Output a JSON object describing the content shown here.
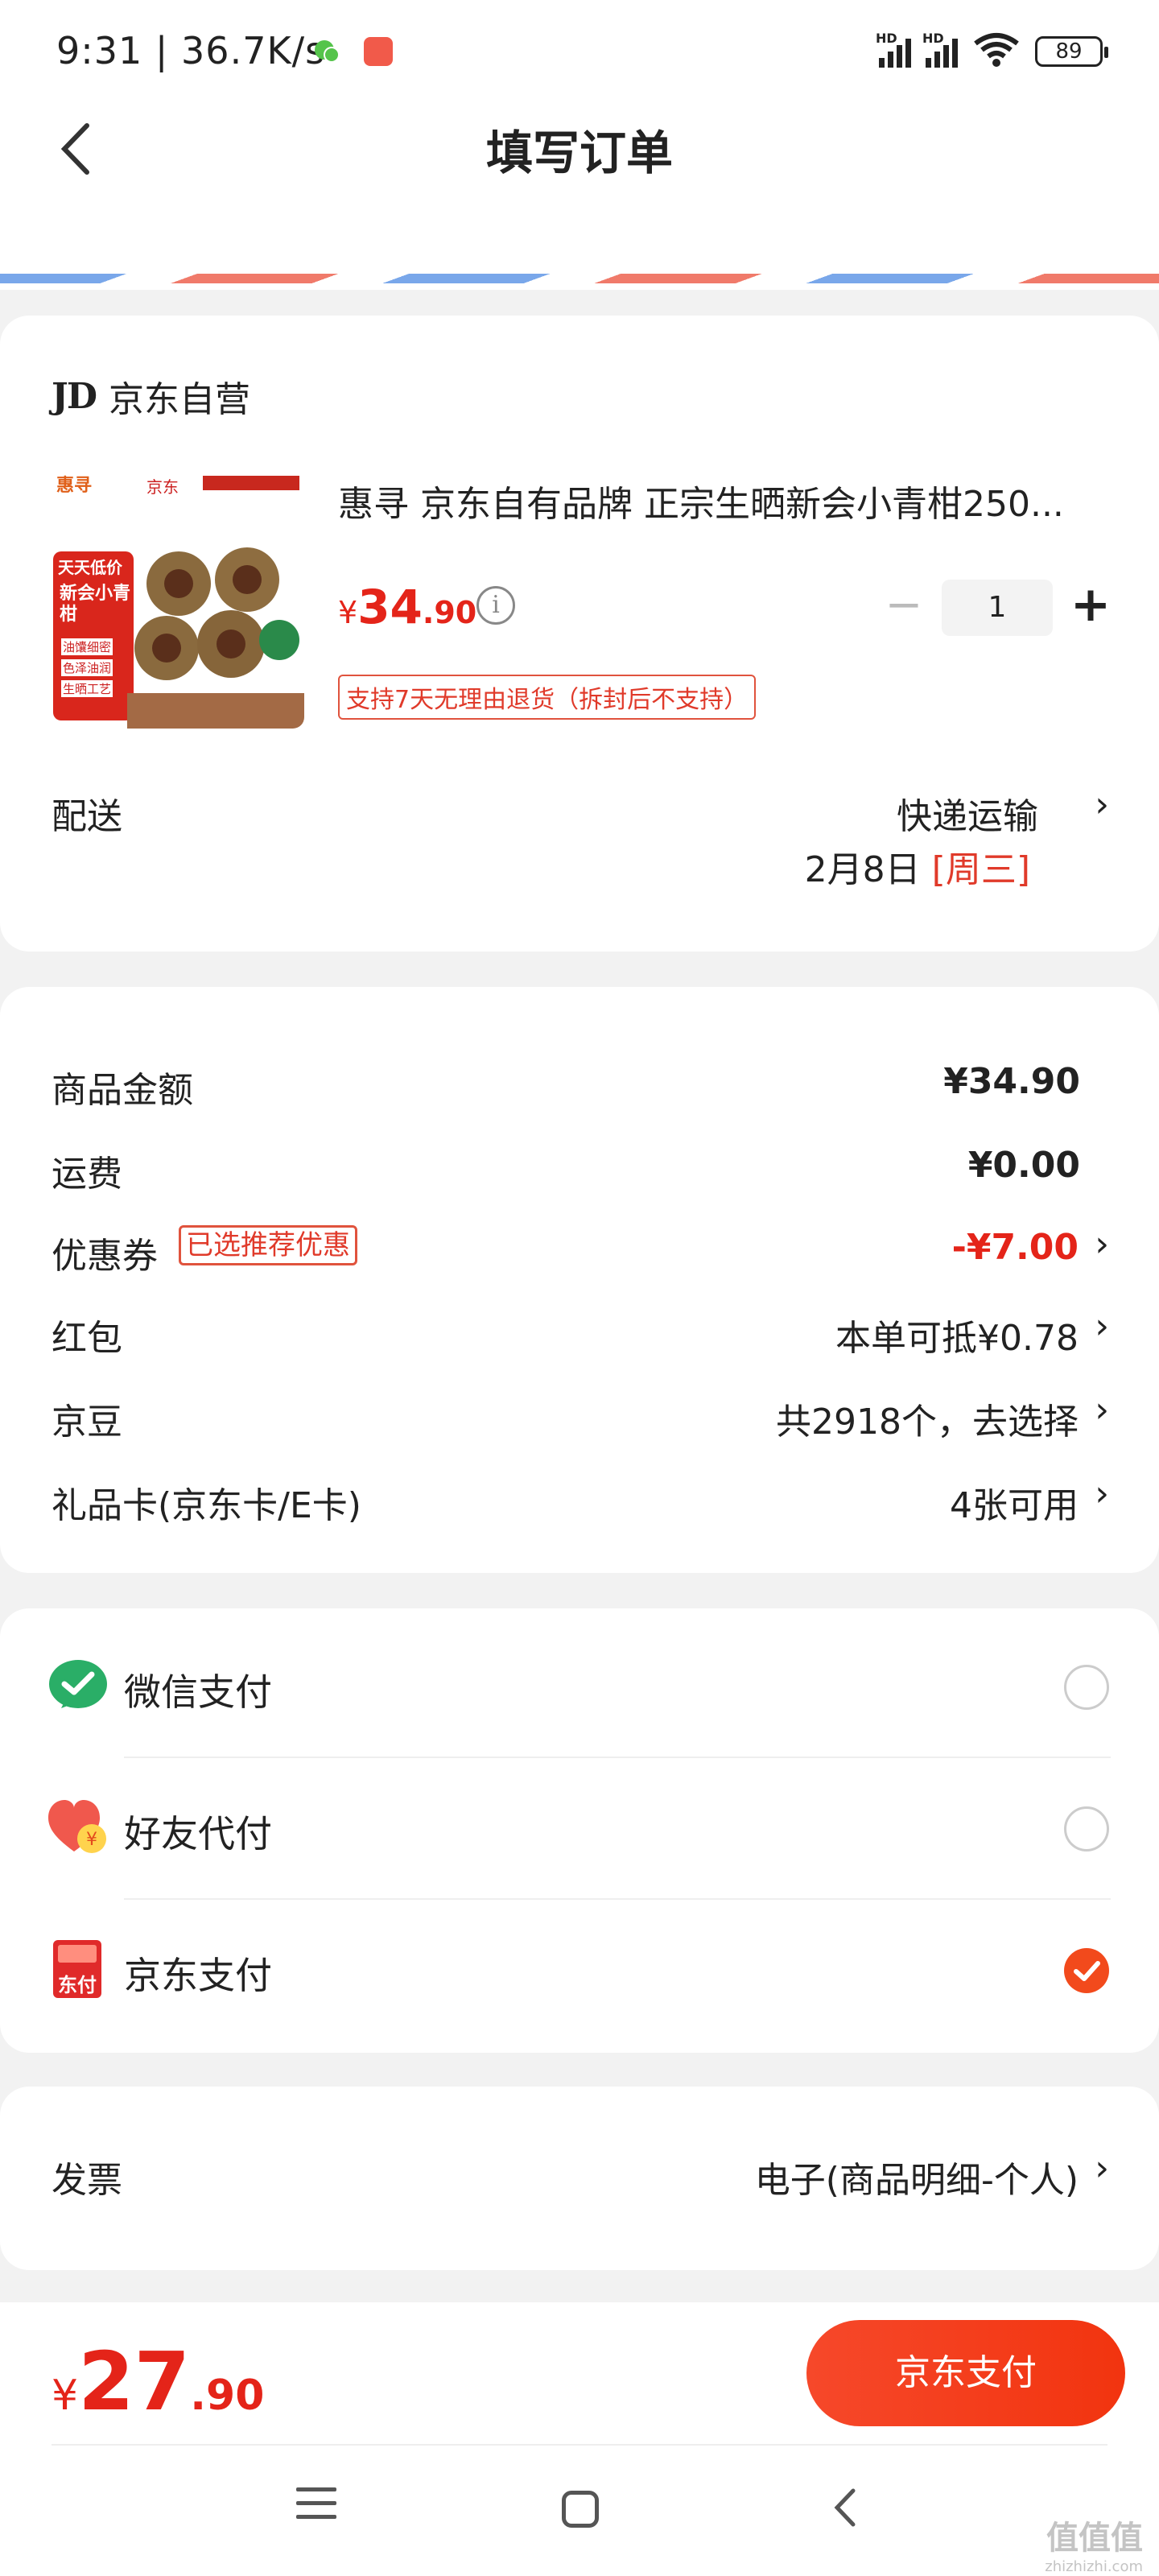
{
  "status_bar": {
    "time": "9:31 | 36.7K/s",
    "battery": "89",
    "signal_label_1": "HD",
    "signal_label_2": "HD",
    "wifi_sub": "6"
  },
  "header": {
    "title": "填写订单"
  },
  "shop": {
    "logo": "JD",
    "name": "京东自营"
  },
  "product": {
    "name": "惠寻 京东自有品牌 正宗生晒新会小青柑250...",
    "price_symbol": "¥",
    "price_int": "34",
    "price_dec": ".90",
    "quantity": "1",
    "return_policy": "支持7天无理由退货（拆封后不支持）",
    "image_texts": {
      "brand": "惠寻",
      "jd": "京东",
      "badge": "天天低价",
      "name": "新会小青柑",
      "tag1": "油馕细密",
      "tag2": "色泽油润",
      "tag3": "生晒工艺"
    }
  },
  "shipping": {
    "label": "配送",
    "method": "快递运输",
    "date": "2月8日",
    "weekday": "[周三]"
  },
  "costs": {
    "goods_label": "商品金额",
    "goods_value": "¥34.90",
    "freight_label": "运费",
    "freight_value": "¥0.00",
    "coupon_label": "优惠券",
    "coupon_tag": "已选推荐优惠",
    "coupon_value": "-¥7.00",
    "redpacket_label": "红包",
    "redpacket_value": "本单可抵¥0.78",
    "jingdou_label": "京豆",
    "jingdou_value": "共2918个，去选择",
    "giftcard_label": "礼品卡(京东卡/E卡)",
    "giftcard_value": "4张可用"
  },
  "payment": {
    "methods": [
      {
        "label": "微信支付",
        "selected": false
      },
      {
        "label": "好友代付",
        "selected": false
      },
      {
        "label": "京东支付",
        "selected": true
      }
    ],
    "jd_icon_text": "东付"
  },
  "invoice": {
    "label": "发票",
    "value": "电子(商品明细-个人)"
  },
  "footer": {
    "total_symbol": "¥",
    "total_int": "27",
    "total_dec": ".90",
    "pay_button": "京东支付"
  },
  "watermark": {
    "main": "值值值",
    "sub": "zhizhizhi.com"
  },
  "colors": {
    "accent_red": "#e42419",
    "pay_button": "#f4401d",
    "wechat_green": "#2aae67"
  }
}
